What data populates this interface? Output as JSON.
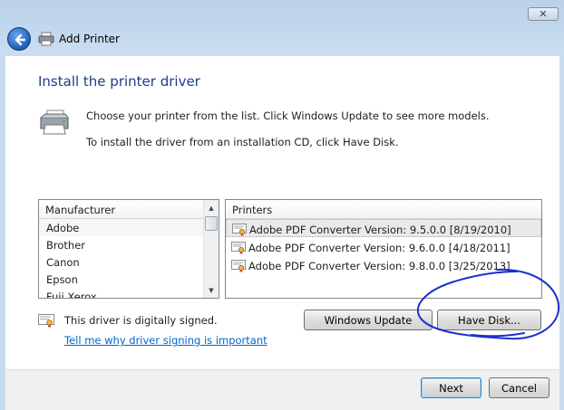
{
  "window": {
    "title": "Add Printer",
    "close_glyph": "✕"
  },
  "heading": "Install the printer driver",
  "instructions": {
    "line1": "Choose your printer from the list. Click Windows Update to see more models.",
    "line2": "To install the driver from an installation CD, click Have Disk."
  },
  "manufacturer_list": {
    "header": "Manufacturer",
    "items": [
      "Adobe",
      "Brother",
      "Canon",
      "Epson",
      "Fuji Xerox"
    ]
  },
  "printers_list": {
    "header": "Printers",
    "items": [
      "Adobe PDF Converter Version: 9.5.0.0 [8/19/2010]",
      "Adobe PDF Converter Version: 9.6.0.0 [4/18/2011]",
      "Adobe PDF Converter Version: 9.8.0.0 [3/25/2013]"
    ]
  },
  "signing": {
    "status": "This driver is digitally signed.",
    "link": "Tell me why driver signing is important"
  },
  "buttons": {
    "windows_update": "Windows Update",
    "have_disk": "Have Disk...",
    "next": "Next",
    "cancel": "Cancel"
  },
  "colors": {
    "heading": "#1e3d87",
    "link": "#0066cc",
    "annotation": "#1a2fd0"
  },
  "icons": [
    "back-arrow-icon",
    "printer-icon",
    "certificate-icon",
    "scroll-up-icon",
    "scroll-down-icon",
    "close-icon"
  ]
}
